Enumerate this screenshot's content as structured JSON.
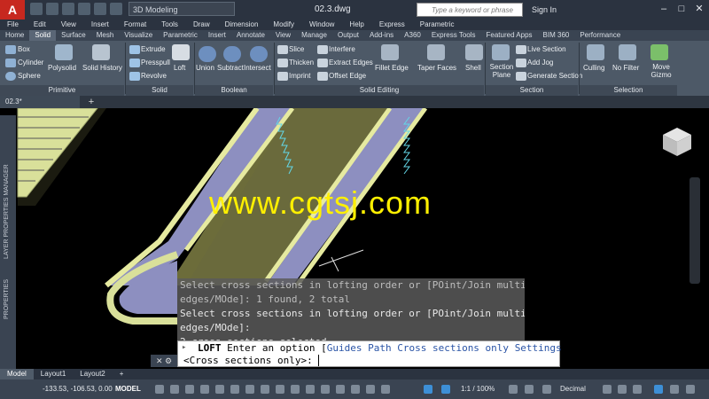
{
  "app": {
    "logo_letter": "A",
    "workspace": "3D Modeling",
    "document_title": "02.3.dwg",
    "search_placeholder": "Type a keyword or phrase",
    "sign_in": "Sign In"
  },
  "menus": [
    "File",
    "Edit",
    "View",
    "Insert",
    "Format",
    "Tools",
    "Draw",
    "Dimension",
    "Modify",
    "Window",
    "Help",
    "Express",
    "Parametric"
  ],
  "ribbon_tabs": [
    "Home",
    "Solid",
    "Surface",
    "Mesh",
    "Visualize",
    "Parametric",
    "Insert",
    "Annotate",
    "View",
    "Manage",
    "Output",
    "Add-ins",
    "A360",
    "Express Tools",
    "Featured Apps",
    "BIM 360",
    "Performance"
  ],
  "ribbon_active_tab": "Solid",
  "ribbon": {
    "primitive": {
      "title": "Primitive",
      "items": [
        "Box",
        "Cylinder",
        "Sphere"
      ],
      "big": [
        "Polysolid",
        "Solid History"
      ]
    },
    "solid": {
      "title": "Solid",
      "items": [
        "Extrude",
        "Presspull",
        "Revolve"
      ],
      "big": [
        "Loft"
      ]
    },
    "boolean": {
      "title": "Boolean",
      "big": [
        "Union",
        "Subtract",
        "Intersect"
      ]
    },
    "solid_editing": {
      "title": "Solid Editing",
      "col1": [
        "Slice",
        "Thicken",
        "Imprint"
      ],
      "col2": [
        "Interfere",
        "Extract Edges",
        "Offset Edge"
      ],
      "big": [
        "Fillet Edge",
        "Taper Faces",
        "Shell"
      ]
    },
    "section": {
      "title": "Section",
      "big": [
        "Section Plane"
      ],
      "items": [
        "Live Section",
        "Add Jog",
        "Generate Section"
      ]
    },
    "selection": {
      "title": "Selection",
      "big": [
        "Culling",
        "No Filter",
        "Move Gizmo"
      ]
    }
  },
  "file_tab": "02.3*",
  "palettes": [
    "PROPERTIES",
    "LAYER PROPERTIES MANAGER"
  ],
  "watermark": "www.cgtsj.com",
  "command_history": [
    "Select cross sections in lofting order or [POint/Join multiple",
    "edges/MOde]: 1 found, 2 total",
    "Select cross sections in lofting order or [POint/Join multiple",
    "edges/MOde]:",
    "2 cross sections selected"
  ],
  "command": {
    "name": "LOFT",
    "prompt": "Enter an option [",
    "options": [
      "Guides",
      "Path",
      "Cross sections only",
      "Settings"
    ],
    "close": "]",
    "default": "<Cross sections only>:"
  },
  "layout_tabs": [
    "Model",
    "Layout1",
    "Layout2"
  ],
  "status": {
    "coords": "-133.53, -106.53, 0.00",
    "space": "MODEL",
    "scale": "1:1 / 100%",
    "units": "Decimal"
  },
  "colors": {
    "accent_red": "#c7281f",
    "watermark": "#fff000",
    "ribbon_bg": "#4d5967"
  }
}
